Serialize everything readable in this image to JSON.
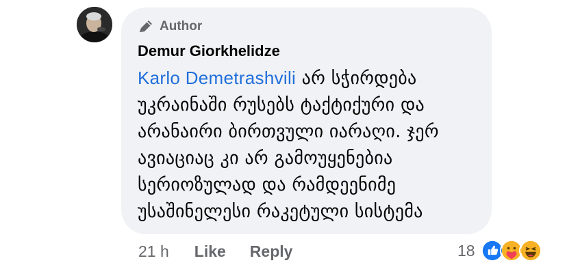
{
  "comment": {
    "author_badge": "Author",
    "commenter_name": "Demur Giorkhelidze",
    "mention": "Karlo Demetrashvili",
    "text": " არ სჭირდება უკრაინაში რუსებს ტაქტიქური და არანაირი ბირთვული იარაღი. ჯერ ავიაციაც კი არ გამოუყენებია სერიოზულად და რამდეენიმე უსაშინელესი რაკეტული სისტემა"
  },
  "actions": {
    "time": "21 h",
    "like_label": "Like",
    "reply_label": "Reply"
  },
  "reactions": {
    "count": "18",
    "icons": [
      "like-reaction-icon",
      "care-reaction-icon",
      "haha-reaction-icon"
    ]
  },
  "colors": {
    "bubble": "#f0f2f5",
    "mention": "#216fdb",
    "muted": "#65676b",
    "text": "#050505"
  }
}
